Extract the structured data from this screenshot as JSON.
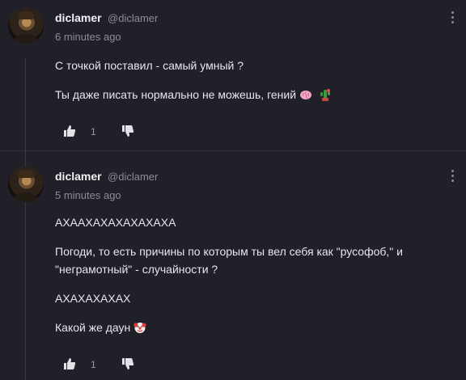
{
  "comments": [
    {
      "username": "diclamer",
      "handle": "@diclamer",
      "time": "6 minutes ago",
      "paragraphs": [
        "С точкой поставил - самый умный ?",
        "Ты даже писать нормально не можешь, гений"
      ],
      "emojis": [
        "brain-emoji",
        "cactus-emoji"
      ],
      "likes": "1"
    },
    {
      "username": "diclamer",
      "handle": "@diclamer",
      "time": "5 minutes ago",
      "paragraphs": [
        "АХААХАХАХАХАХАХА",
        "Погоди, то есть причины по которым ты вел себя как \"русофоб,\" и",
        "\"неграмотный\" - случайности ?",
        "АХАХАХАХАХ",
        "Какой же даун"
      ],
      "emojis": [
        "clown-emoji"
      ],
      "likes": "1"
    }
  ],
  "icons": {
    "like": "thumbs-up-icon",
    "dislike": "thumbs-down-icon",
    "more": "vertical-dots-icon"
  },
  "colors": {
    "background": "#211f27",
    "text": "#e8e6ec",
    "muted": "#8e8b96"
  }
}
